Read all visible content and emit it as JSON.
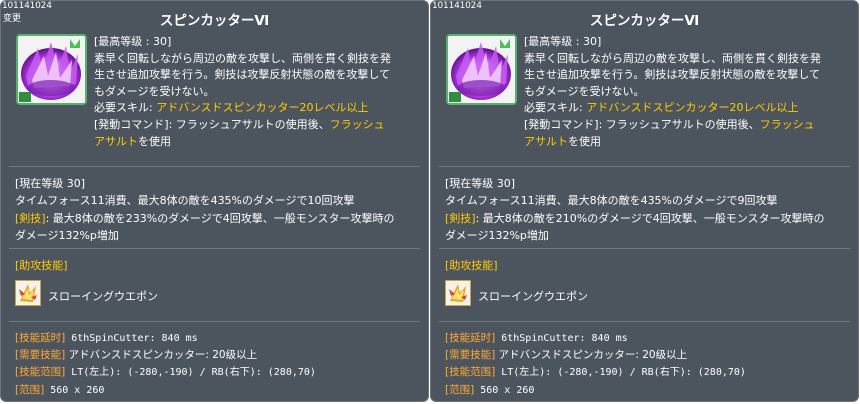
{
  "panels": [
    {
      "skill_id": "101141024",
      "changed_label": "变更",
      "title": "スピンカッターⅥ",
      "icon": "purple-spin-cutter-icon",
      "desc": {
        "max_level": "[最高等级 : 30]",
        "line1": "素早く回転しながら周辺の敵を攻撃し、両側を貫く剣技を発",
        "line2": "生させ追加攻撃を行う。剣技は攻撃反射状態の敵を攻撃して",
        "line3": "もダメージを受けない。",
        "req_label": "必要スキル: ",
        "req_value": "アドバンスドスピンカッター20レベル以上",
        "cmd_label": "[発動コマンド]: フラッシュアサルトの使用後、",
        "cmd_value1": "フラッシュ",
        "cmd_value2": "アサルト",
        "cmd_tail": "を使用"
      },
      "current": {
        "level": "[現在等级 30]",
        "line1": "タイムフォース11消費、最大8体の敵を435%のダメージで10回攻撃",
        "sword_label": "[剣技]",
        "line2": ": 最大8体の敵を233%のダメージで4回攻撃、一般モンスター攻撃時の",
        "line3": "ダメージ132%p増加"
      },
      "assist": {
        "title": "[助攻技能]",
        "icon": "throwing-weapon-icon",
        "label": "スローイングウエポン"
      },
      "stats": {
        "delay_label": "[技能延时]",
        "delay_value": " 6thSpinCutter: 840 ms",
        "need_label": "[需要技能]",
        "need_value": " アドバンスドスピンカッター: 20级以上",
        "range_label": "[技能范围]",
        "range_value": " LT(左上): (-280,-190) / RB(右下): (280,70)",
        "area_label": "[范围]",
        "area_value": " 560 x 260"
      }
    },
    {
      "skill_id": "101141024",
      "changed_label": "",
      "title": "スピンカッターⅥ",
      "icon": "purple-spin-cutter-icon",
      "desc": {
        "max_level": "[最高等级 : 30]",
        "line1": "素早く回転しながら周辺の敵を攻撃し、両側を貫く剣技を発",
        "line2": "生させ追加攻撃を行う。剣技は攻撃反射状態の敵を攻撃して",
        "line3": "もダメージを受けない。",
        "req_label": "必要スキル: ",
        "req_value": "アドバンスドスピンカッター20レベル以上",
        "cmd_label": "[発動コマンド]: フラッシュアサルトの使用後、",
        "cmd_value1": "フラッシュ",
        "cmd_value2": "アサルト",
        "cmd_tail": "を使用"
      },
      "current": {
        "level": "[現在等级 30]",
        "line1": "タイムフォース11消費、最大8体の敵を435%のダメージで9回攻撃",
        "sword_label": "[剣技]",
        "line2": ": 最大8体の敵を210%のダメージで4回攻撃、一般モンスター攻撃時の",
        "line3": "ダメージ132%p増加"
      },
      "assist": {
        "title": "[助攻技能]",
        "icon": "throwing-weapon-icon",
        "label": "スローイングウエポン"
      },
      "stats": {
        "delay_label": "[技能延时]",
        "delay_value": " 6thSpinCutter: 840 ms",
        "need_label": "[需要技能]",
        "need_value": " アドバンスドスピンカッター: 20级以上",
        "range_label": "[技能范围]",
        "range_value": " LT(左上): (-280,-190) / RB(右下): (280,70)",
        "area_label": "[范围]",
        "area_value": " 560 x 260"
      }
    }
  ],
  "colors": {
    "panel_bg": "#4c545e",
    "highlight_yellow": "#ffcc00",
    "stat_orange": "#ffaa33",
    "icon_border": "#53b36a"
  }
}
